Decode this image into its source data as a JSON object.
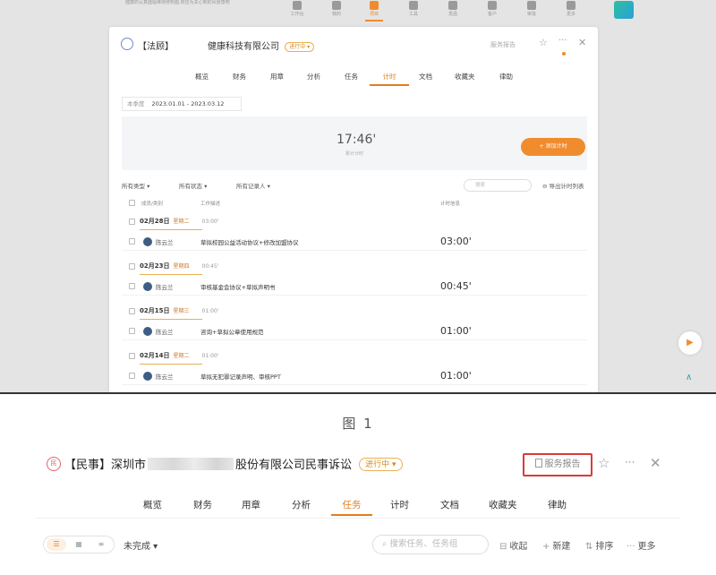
{
  "figure1": {
    "notice": "健康的认真面临维持修到面,转应为关心到的风景感吧",
    "topnav": [
      {
        "label": "工作台",
        "icon": "home-icon"
      },
      {
        "label": "我的",
        "icon": "user-icon"
      },
      {
        "label": "项目",
        "icon": "folder-icon",
        "active": true
      },
      {
        "label": "工具",
        "icon": "tool-icon"
      },
      {
        "label": "发函",
        "icon": "mail-icon"
      },
      {
        "label": "客户",
        "icon": "client-icon"
      },
      {
        "label": "审批",
        "icon": "approve-icon"
      },
      {
        "label": "更多",
        "icon": "grid-icon"
      }
    ],
    "panel": {
      "title_prefix": "【法顾】",
      "title_suffix": "健康科技有限公司",
      "status": "进行中 ▾",
      "report": "服务报告",
      "tabs": [
        "概览",
        "财务",
        "用章",
        "分析",
        "任务",
        "计时",
        "文档",
        "收藏夹",
        "律助"
      ],
      "active_tab": "计时",
      "date_label": "本季度",
      "date_value": "2023.01.01 - 2023.03.12",
      "timer_value": "17:46'",
      "timer_label": "累计计时",
      "add_timer": "+ 添加计时",
      "filters": [
        "所有类型 ▾",
        "所有状态 ▾",
        "所有记录人 ▾"
      ],
      "search_placeholder": "搜索",
      "export": "导出计时列表",
      "columns": {
        "member": "成员/类别",
        "desc": "工作描述",
        "time": "计时信息"
      },
      "groups": [
        {
          "date": "02月28日",
          "weekday": "星期二",
          "total": "03:00'",
          "name": "陈云兰",
          "desc": "草拟校园公益活动协议+修改加盟协议",
          "time": "03:00'"
        },
        {
          "date": "02月23日",
          "weekday": "星期四",
          "total": "00:45'",
          "name": "陈云兰",
          "desc": "审核基金会协议+草拟声明书",
          "time": "00:45'"
        },
        {
          "date": "02月15日",
          "weekday": "星期三",
          "total": "01:00'",
          "name": "陈云兰",
          "desc": "咨询+草拟公章使用规范",
          "time": "01:00'"
        },
        {
          "date": "02月14日",
          "weekday": "星期二",
          "total": "01:00'",
          "name": "陈云兰",
          "desc": "草拟无犯罪记录声明、审核PPT",
          "time": "01:00'"
        }
      ]
    }
  },
  "caption": "图 1",
  "figure2": {
    "icon_text": "民",
    "title_prefix": "【民事】深圳市",
    "title_suffix": "股份有限公司民事诉讼",
    "status": "进行中 ▾",
    "report": "服务报告",
    "tabs": [
      "概览",
      "财务",
      "用章",
      "分析",
      "任务",
      "计时",
      "文档",
      "收藏夹",
      "律助"
    ],
    "active_tab": "任务",
    "filter": "未完成 ▾",
    "search_placeholder": "搜索任务、任务组",
    "actions": [
      {
        "icon": "⊟",
        "label": "收起"
      },
      {
        "icon": "+",
        "label": "新建"
      },
      {
        "icon": "⇅",
        "label": "排序"
      },
      {
        "icon": "···",
        "label": "更多"
      }
    ]
  }
}
